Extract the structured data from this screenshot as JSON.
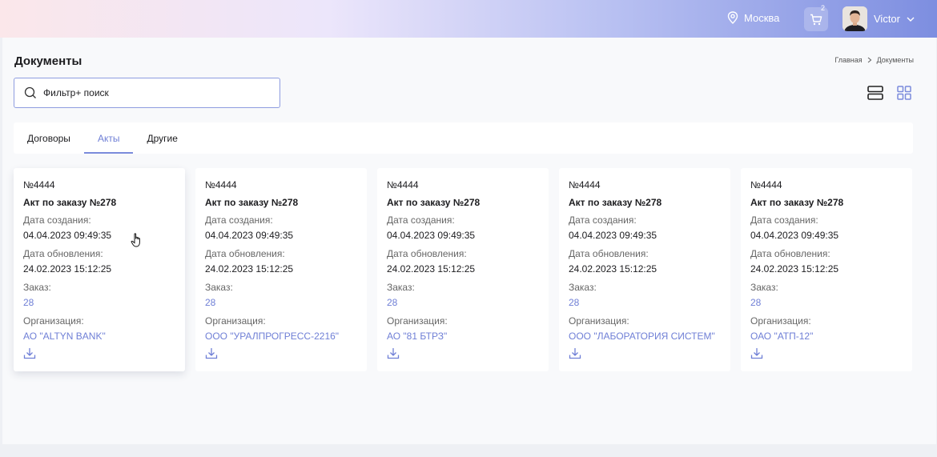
{
  "header": {
    "location": "Москва",
    "cart_count": "2",
    "user_name": "Victor"
  },
  "page": {
    "title": "Документы",
    "breadcrumb": [
      "Главная",
      "Документы"
    ]
  },
  "search": {
    "placeholder": "Фильтр+ поиск"
  },
  "tabs": [
    {
      "label": "Договоры",
      "active": false
    },
    {
      "label": "Акты",
      "active": true
    },
    {
      "label": "Другие",
      "active": false
    }
  ],
  "card_labels": {
    "created": "Дата создания:",
    "updated": "Дата обновления:",
    "order": "Заказ:",
    "org": "Организация:"
  },
  "cards": [
    {
      "number": "№4444",
      "title": "Акт по заказу №278",
      "created": "04.04.2023 09:49:35",
      "updated": "24.02.2023 15:12:25",
      "order": "28",
      "org": "АО \"ALTYN BANK\""
    },
    {
      "number": "№4444",
      "title": "Акт по заказу №278",
      "created": "04.04.2023 09:49:35",
      "updated": "24.02.2023 15:12:25",
      "order": "28",
      "org": "ООО \"УРАЛПРОГРЕСС-2216\""
    },
    {
      "number": "№4444",
      "title": "Акт по заказу №278",
      "created": "04.04.2023 09:49:35",
      "updated": "24.02.2023 15:12:25",
      "order": "28",
      "org": "АО \"81 БТРЗ\""
    },
    {
      "number": "№4444",
      "title": "Акт по заказу №278",
      "created": "04.04.2023 09:49:35",
      "updated": "24.02.2023 15:12:25",
      "order": "28",
      "org": "ООО \"ЛАБОРАТОРИЯ СИСТЕМ\""
    },
    {
      "number": "№4444",
      "title": "Акт по заказу №278",
      "created": "04.04.2023 09:49:35",
      "updated": "24.02.2023 15:12:25",
      "order": "28",
      "org": "ОАО \"АТП-12\""
    }
  ],
  "colors": {
    "accent": "#6f7fd6",
    "header_gradient_end": "#7d8ee0"
  },
  "icons": [
    "location-icon",
    "cart-icon",
    "chevron-down-icon",
    "search-icon",
    "list-view-icon",
    "grid-view-icon",
    "download-icon",
    "hand-cursor-icon"
  ]
}
